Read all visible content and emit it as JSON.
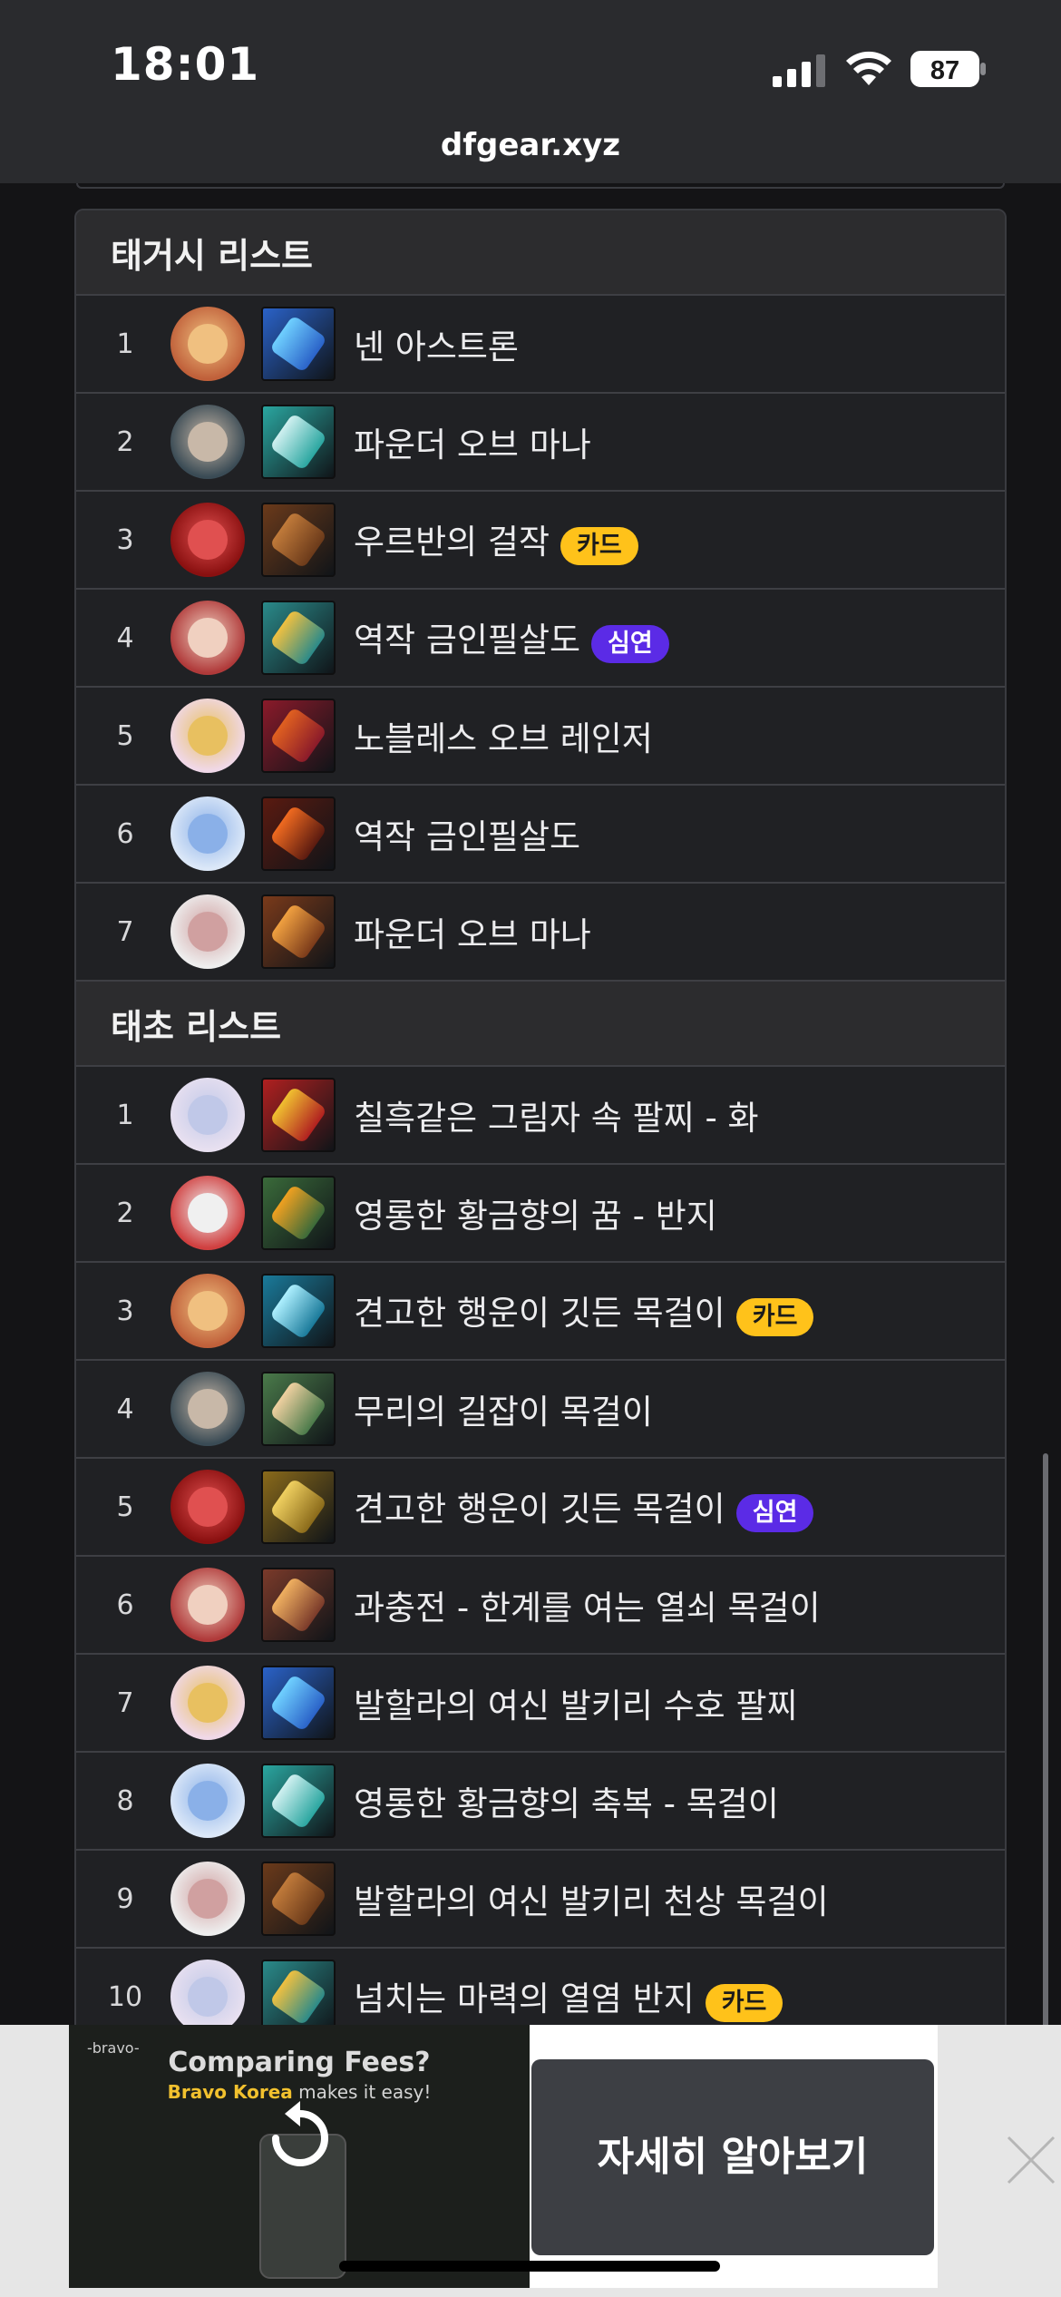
{
  "status_bar": {
    "time": "18:01",
    "battery": "87"
  },
  "browser": {
    "url": "dfgear.xyz"
  },
  "sections": [
    {
      "title": "태거시 리스트",
      "items": [
        {
          "rank": "1",
          "name": "넨 아스트론",
          "badge": ""
        },
        {
          "rank": "2",
          "name": "파운더 오브 마나",
          "badge": ""
        },
        {
          "rank": "3",
          "name": "우르반의 걸작",
          "badge": "카드"
        },
        {
          "rank": "4",
          "name": "역작 금인필살도",
          "badge": "심연"
        },
        {
          "rank": "5",
          "name": "노블레스 오브 레인저",
          "badge": ""
        },
        {
          "rank": "6",
          "name": "역작 금인필살도",
          "badge": ""
        },
        {
          "rank": "7",
          "name": "파운더 오브 마나",
          "badge": ""
        }
      ]
    },
    {
      "title": "태초 리스트",
      "items": [
        {
          "rank": "1",
          "name": "칠흑같은 그림자 속 팔찌 - 화",
          "badge": ""
        },
        {
          "rank": "2",
          "name": "영롱한 황금향의 꿈 - 반지",
          "badge": ""
        },
        {
          "rank": "3",
          "name": "견고한 행운이 깃든 목걸이",
          "badge": "카드"
        },
        {
          "rank": "4",
          "name": "무리의 길잡이 목걸이",
          "badge": ""
        },
        {
          "rank": "5",
          "name": "견고한 행운이 깃든 목걸이",
          "badge": "심연"
        },
        {
          "rank": "6",
          "name": "과충전 - 한계를 여는 열쇠 목걸이",
          "badge": ""
        },
        {
          "rank": "7",
          "name": "발할라의 여신 발키리 수호 팔찌",
          "badge": ""
        },
        {
          "rank": "8",
          "name": "영롱한 황금향의 축복 - 목걸이",
          "badge": ""
        },
        {
          "rank": "9",
          "name": "발할라의 여신 발키리 천상 목걸이",
          "badge": ""
        },
        {
          "rank": "10",
          "name": "넘치는 마력의 열염 반지",
          "badge": "카드"
        }
      ]
    }
  ],
  "ad": {
    "logo": "-bravo-",
    "headline": "Comparing Fees?",
    "sub_brand": "Bravo Korea",
    "sub_rest": " makes it easy!",
    "cta": "자세히 알아보기"
  },
  "colors": {
    "badge_card": "#ffc21a",
    "badge_deep": "#5b2be6"
  }
}
